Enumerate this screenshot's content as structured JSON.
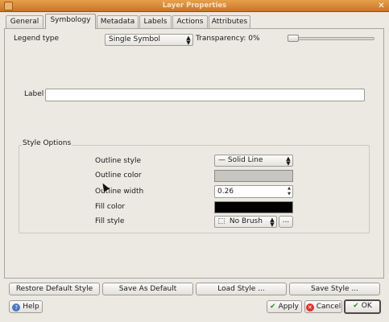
{
  "window": {
    "title": "Layer Properties"
  },
  "tabs": [
    {
      "label": "General"
    },
    {
      "label": "Symbology"
    },
    {
      "label": "Metadata"
    },
    {
      "label": "Labels"
    },
    {
      "label": "Actions"
    },
    {
      "label": "Attributes"
    }
  ],
  "active_tab": "Symbology",
  "legend": {
    "label": "Legend type",
    "value": "Single Symbol"
  },
  "transparency": {
    "label": "Transparency: 0%",
    "value_percent": 0
  },
  "label_field": {
    "label": "Label",
    "value": ""
  },
  "style_options": {
    "title": "Style Options",
    "outline_style": {
      "label": "Outline style",
      "value": "Solid Line",
      "glyph": "—"
    },
    "outline_color": {
      "label": "Outline color",
      "color": "#c8c6c1"
    },
    "outline_width": {
      "label": "Outline width",
      "value": "0.26"
    },
    "fill_color": {
      "label": "Fill color",
      "color": "#000000"
    },
    "fill_style": {
      "label": "Fill style",
      "value": "No Brush",
      "more_label": "..."
    }
  },
  "bottom_buttons": {
    "restore": "Restore Default Style",
    "save_default": "Save As Default",
    "load_style": "Load Style ...",
    "save_style": "Save Style ..."
  },
  "dialog_buttons": {
    "help": "Help",
    "apply": "Apply",
    "cancel": "Cancel",
    "ok": "OK"
  },
  "colors": {
    "titlebar": "#d48836",
    "dialog_bg": "#ece9e3"
  }
}
